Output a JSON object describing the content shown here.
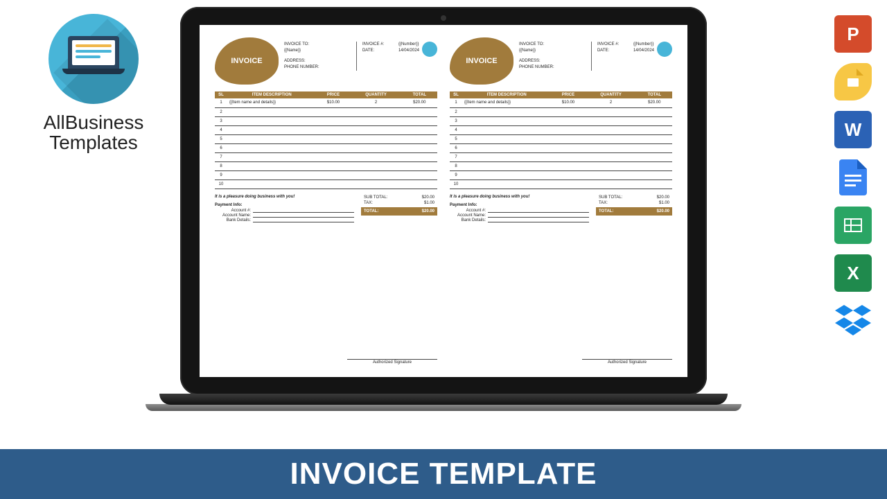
{
  "brand": {
    "line1": "AllBusiness",
    "line2": "Templates"
  },
  "footer_title": "INVOICE TEMPLATE",
  "formats": [
    "P",
    "",
    "W",
    "",
    "",
    "X",
    ""
  ],
  "invoice": {
    "title": "INVOICE",
    "to_label": "INVOICE TO:",
    "to_value": "{{Name}}",
    "address_label": "ADDRESS:",
    "phone_label": "PHONE NUMBER:",
    "num_label": "INVOICE #:",
    "num_value": "{{Number}}",
    "date_label": "DATE:",
    "date_value": "14/04/2024",
    "cols": {
      "sl": "SL",
      "desc": "ITEM DESCRIPTION",
      "price": "PRICE",
      "qty": "QUANTITY",
      "total": "TOTAL"
    },
    "rows": [
      {
        "sl": "1",
        "desc": "{{Item name and details}}",
        "price": "$10.00",
        "qty": "2",
        "total": "$20.00"
      },
      {
        "sl": "2",
        "desc": "",
        "price": "",
        "qty": "",
        "total": ""
      },
      {
        "sl": "3",
        "desc": "",
        "price": "",
        "qty": "",
        "total": ""
      },
      {
        "sl": "4",
        "desc": "",
        "price": "",
        "qty": "",
        "total": ""
      },
      {
        "sl": "5",
        "desc": "",
        "price": "",
        "qty": "",
        "total": ""
      },
      {
        "sl": "6",
        "desc": "",
        "price": "",
        "qty": "",
        "total": ""
      },
      {
        "sl": "7",
        "desc": "",
        "price": "",
        "qty": "",
        "total": ""
      },
      {
        "sl": "8",
        "desc": "",
        "price": "",
        "qty": "",
        "total": ""
      },
      {
        "sl": "9",
        "desc": "",
        "price": "",
        "qty": "",
        "total": ""
      },
      {
        "sl": "10",
        "desc": "",
        "price": "",
        "qty": "",
        "total": ""
      }
    ],
    "pleasure": "It is a pleasure doing business with you!",
    "payment_title": "Payment Info:",
    "payment_fields": {
      "acct": "Account #:",
      "name": "Account Name:",
      "bank": "Bank Details:"
    },
    "subtotal_label": "SUB TOTAL:",
    "subtotal": "$20.00",
    "tax_label": "TAX:",
    "tax": "$1.00",
    "total_label": "TOTAL:",
    "total": "$20.00",
    "sig": "Authorized Signature"
  }
}
